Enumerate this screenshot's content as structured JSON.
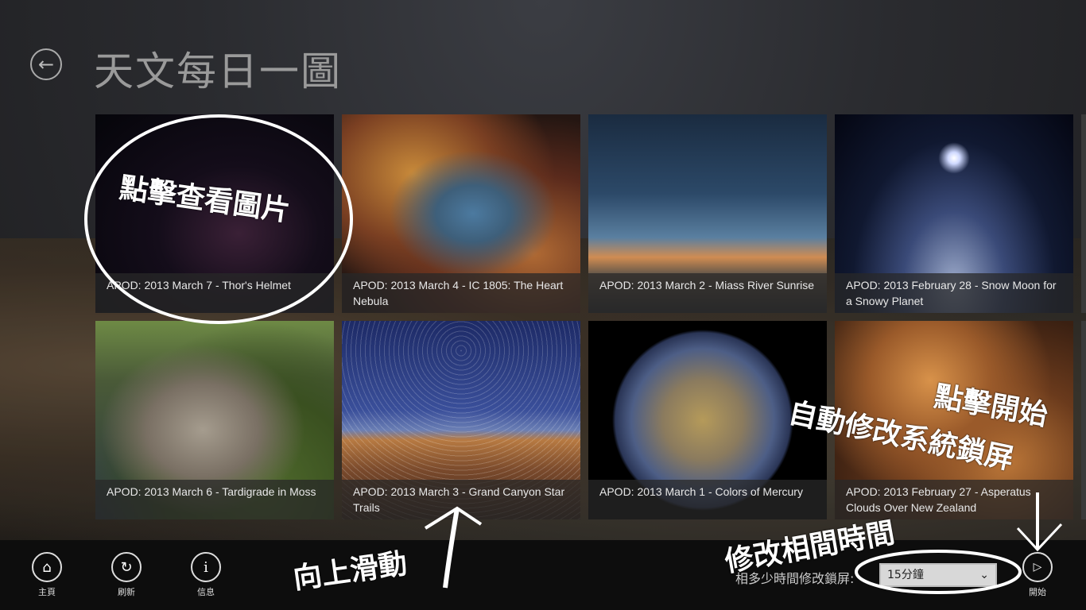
{
  "page_title": "天文每日一圖",
  "tiles": [
    {
      "caption": "APOD: 2013 March 7 - Thor's Helmet"
    },
    {
      "caption": "APOD: 2013 March 4 - IC 1805: The Heart Nebula"
    },
    {
      "caption": "APOD: 2013 March 2 - Miass River Sunrise"
    },
    {
      "caption": "APOD: 2013 February 28 - Snow Moon for a Snowy Planet"
    },
    {
      "caption": "APOD: 2013 March 6 - Tardigrade in Moss"
    },
    {
      "caption": "APOD: 2013 March 3 - Grand Canyon Star Trails"
    },
    {
      "caption": "APOD: 2013 March 1 - Colors of Mercury"
    },
    {
      "caption": "APOD: 2013 February 27 - Asperatus Clouds Over New Zealand"
    }
  ],
  "app_bar": {
    "home": "主頁",
    "refresh": "刷新",
    "info": "信息",
    "interval_label": "相多少時間修改鎖屏:",
    "interval_value": "15分鐘",
    "start": "開始"
  },
  "annotations": {
    "click_view": "點擊查看圖片",
    "swipe_up": "向上滑動",
    "modify_interval": "修改相間時間",
    "auto_modify": "自動修改系統鎖屏",
    "click_start": "點擊開始"
  }
}
